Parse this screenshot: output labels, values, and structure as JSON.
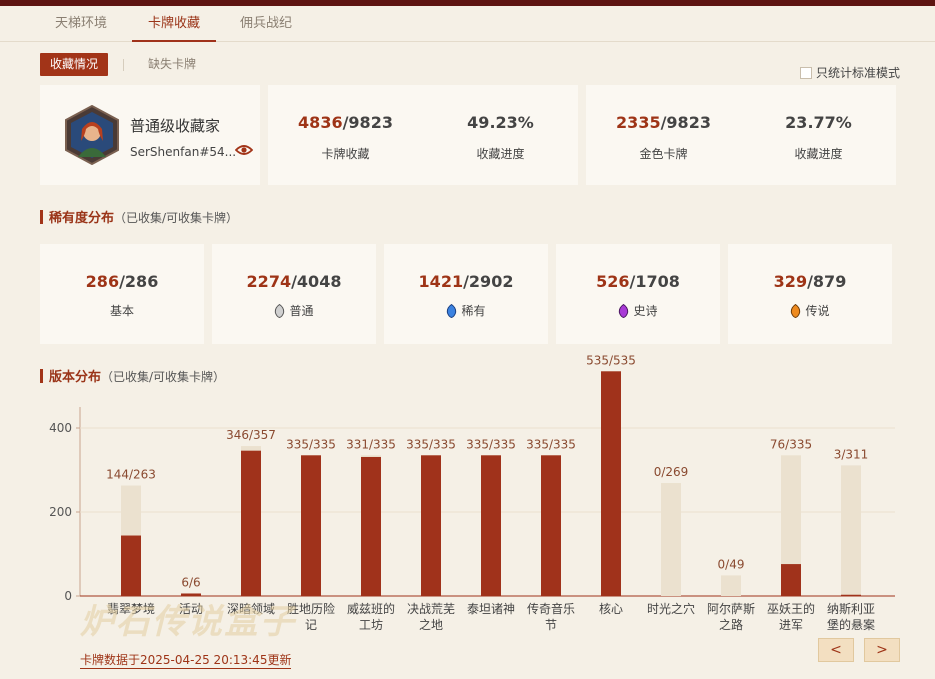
{
  "tabs": [
    {
      "label": "天梯环境"
    },
    {
      "label": "卡牌收藏"
    },
    {
      "label": "佣兵战纪"
    }
  ],
  "subtabs": {
    "collection": "收藏情况",
    "missing": "缺失卡牌"
  },
  "standard_only_label": "只统计标准模式",
  "profile": {
    "title": "普通级收藏家",
    "battletag": "SerShenfan#54..."
  },
  "stats": [
    {
      "have": "4836",
      "total": "/9823",
      "label": "卡牌收藏"
    },
    {
      "value": "49.23%",
      "label": "收藏进度"
    },
    {
      "have": "2335",
      "total": "/9823",
      "label": "金色卡牌"
    },
    {
      "value": "23.77%",
      "label": "收藏进度"
    }
  ],
  "rarity_section": {
    "title": "稀有度分布",
    "subtitle": "（已收集/可收集卡牌）"
  },
  "rarities": [
    {
      "have": "286",
      "total": "/286",
      "label": "基本",
      "gem": "none",
      "color": ""
    },
    {
      "have": "2274",
      "total": "/4048",
      "label": "普通",
      "gem": "common-gem-icon",
      "color": "#8a8a8a"
    },
    {
      "have": "1421",
      "total": "/2902",
      "label": "稀有",
      "gem": "rare-gem-icon",
      "color": "#2f6fd0"
    },
    {
      "have": "526",
      "total": "/1708",
      "label": "史诗",
      "gem": "epic-gem-icon",
      "color": "#9b2fc9"
    },
    {
      "have": "329",
      "total": "/879",
      "label": "传说",
      "gem": "legendary-gem-icon",
      "color": "#e07a10"
    }
  ],
  "version_section": {
    "title": "版本分布",
    "subtitle": "（已收集/可收集卡牌）"
  },
  "colors": {
    "accent": "#a0321b",
    "bar_bg": "#ebe1cf",
    "header": "#5e1512"
  },
  "chart_data": {
    "type": "bar",
    "yticks": [
      0,
      200,
      400
    ],
    "ylim": [
      0,
      450
    ],
    "categories": [
      {
        "lines": [
          "翡翠梦境"
        ],
        "collected": 144,
        "total": 263,
        "label": "144/263"
      },
      {
        "lines": [
          "活动"
        ],
        "collected": 6,
        "total": 6,
        "label": "6/6"
      },
      {
        "lines": [
          "深暗领域"
        ],
        "collected": 346,
        "total": 357,
        "label": "346/357"
      },
      {
        "lines": [
          "胜地历险",
          "记"
        ],
        "collected": 335,
        "total": 335,
        "label": "335/335"
      },
      {
        "lines": [
          "威兹班的",
          "工坊"
        ],
        "collected": 331,
        "total": 335,
        "label": "331/335"
      },
      {
        "lines": [
          "决战荒芜",
          "之地"
        ],
        "collected": 335,
        "total": 335,
        "label": "335/335"
      },
      {
        "lines": [
          "泰坦诸神"
        ],
        "collected": 335,
        "total": 335,
        "label": "335/335"
      },
      {
        "lines": [
          "传奇音乐",
          "节"
        ],
        "collected": 335,
        "total": 335,
        "label": "335/335"
      },
      {
        "lines": [
          "核心"
        ],
        "collected": 535,
        "total": 535,
        "label": "535/535"
      },
      {
        "lines": [
          "时光之穴"
        ],
        "collected": 0,
        "total": 269,
        "label": "0/269"
      },
      {
        "lines": [
          "阿尔萨斯",
          "之路"
        ],
        "collected": 0,
        "total": 49,
        "label": "0/49"
      },
      {
        "lines": [
          "巫妖王的",
          "进军"
        ],
        "collected": 76,
        "total": 335,
        "label": "76/335"
      },
      {
        "lines": [
          "纳斯利亚",
          "堡的悬案"
        ],
        "collected": 3,
        "total": 311,
        "label": "3/311"
      }
    ]
  },
  "watermark": "炉石传说盒子",
  "footer": "卡牌数据于2025-04-25 20:13:45更新",
  "nav": {
    "prev": "<",
    "next": ">"
  }
}
